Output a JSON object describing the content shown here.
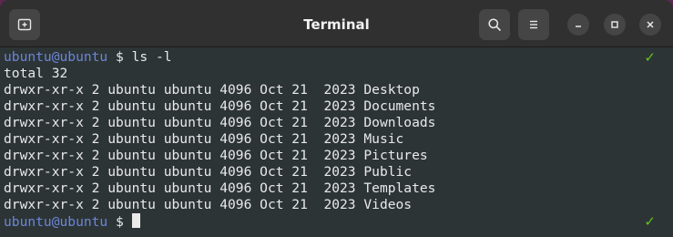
{
  "window": {
    "title": "Terminal"
  },
  "titlebar": {
    "new_tab_icon": "new-tab-icon",
    "search_icon": "search-icon",
    "menu_icon": "hamburger-menu-icon",
    "minimize_icon": "minimize-icon",
    "maximize_icon": "maximize-icon",
    "close_icon": "close-icon"
  },
  "terminal": {
    "prompt_user": "ubuntu@ubuntu",
    "prompt_symbol": "$",
    "command1": "ls -l",
    "total": "total 32",
    "entries": [
      "drwxr-xr-x 2 ubuntu ubuntu 4096 Oct 21  2023 Desktop",
      "drwxr-xr-x 2 ubuntu ubuntu 4096 Oct 21  2023 Documents",
      "drwxr-xr-x 2 ubuntu ubuntu 4096 Oct 21  2023 Downloads",
      "drwxr-xr-x 2 ubuntu ubuntu 4096 Oct 21  2023 Music",
      "drwxr-xr-x 2 ubuntu ubuntu 4096 Oct 21  2023 Pictures",
      "drwxr-xr-x 2 ubuntu ubuntu 4096 Oct 21  2023 Public",
      "drwxr-xr-x 2 ubuntu ubuntu 4096 Oct 21  2023 Templates",
      "drwxr-xr-x 2 ubuntu ubuntu 4096 Oct 21  2023 Videos"
    ],
    "status_mark": "✓"
  },
  "colors": {
    "prompt_user": "#6b86d6",
    "status_ok": "#5dc51f",
    "background": "#2d3436"
  }
}
